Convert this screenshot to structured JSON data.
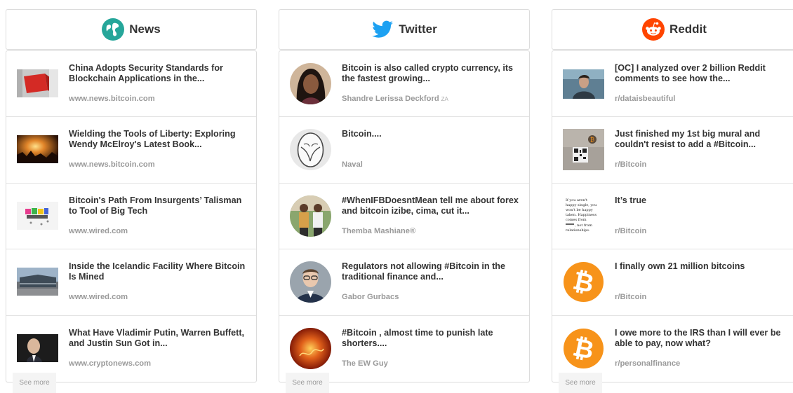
{
  "columns": {
    "news": {
      "title": "News",
      "icon": "globe-icon",
      "accent": "#26a69a",
      "see_more": "See more",
      "items": [
        {
          "title": "China Adopts Security Standards for Blockchain Applications in the...",
          "source": "www.news.bitcoin.com"
        },
        {
          "title": "Wielding the Tools of Liberty: Exploring Wendy McElroy's Latest Book...",
          "source": "www.news.bitcoin.com"
        },
        {
          "title": "Bitcoin's Path From Insurgents’ Talisman to Tool of Big Tech",
          "source": "www.wired.com"
        },
        {
          "title": "Inside the Icelandic Facility Where Bitcoin Is Mined",
          "source": "www.wired.com"
        },
        {
          "title": "What Have Vladimir Putin, Warren Buffett, and Justin Sun Got in...",
          "source": "www.cryptonews.com"
        }
      ]
    },
    "twitter": {
      "title": "Twitter",
      "icon": "twitter-bird-icon",
      "accent": "#1da1f2",
      "see_more": "See more",
      "items": [
        {
          "title": "Bitcoin is also called crypto currency, its the fastest growing...",
          "source": "Shandre Lerissa Deckford",
          "country": "ZA"
        },
        {
          "title": "Bitcoin....",
          "source": "Naval"
        },
        {
          "title": "#WhenIFBDoesntMean tell me about forex and bitcoin izibe, cima, cut it...",
          "source": "Themba Mashiane®"
        },
        {
          "title": "Regulators not allowing #Bitcoin in the traditional finance and...",
          "source": "Gabor Gurbacs"
        },
        {
          "title": "#Bitcoin , almost time to punish late shorters....",
          "source": "The EW Guy"
        }
      ]
    },
    "reddit": {
      "title": "Reddit",
      "icon": "reddit-alien-icon",
      "accent": "#ff4500",
      "see_more": "See more",
      "items": [
        {
          "title": "[OC] I analyzed over 2 billion Reddit comments to see how the...",
          "source": "r/dataisbeautiful"
        },
        {
          "title": "Just finished my 1st big mural and couldn't resist to add a #Bitcoin...",
          "source": "r/Bitcoin"
        },
        {
          "title": "It’s true",
          "source": "r/Bitcoin",
          "thumb_text": [
            "If you aren't",
            "happy single, you",
            "won't be happy",
            "taken. Happiness",
            "comes from",
            ", not from",
            "relationships."
          ]
        },
        {
          "title": "I finally own 21 million bitcoins",
          "source": "r/Bitcoin"
        },
        {
          "title": "I owe more to the IRS than I will ever be able to pay, now what?",
          "source": "r/personalfinance"
        }
      ]
    }
  }
}
